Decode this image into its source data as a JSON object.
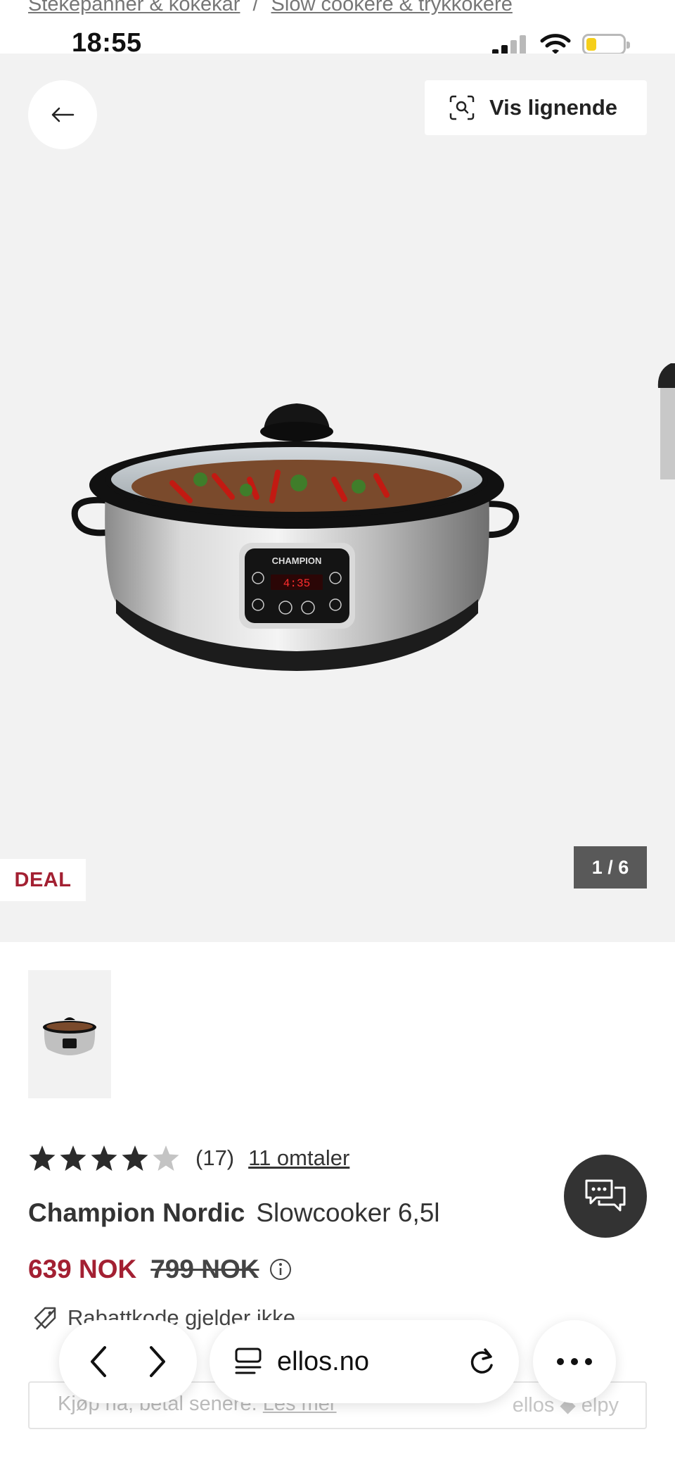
{
  "breadcrumb": {
    "items": [
      "Stekepanner & kokekar",
      "Slow cookere & trykkokere"
    ],
    "separator": "/"
  },
  "status_bar": {
    "time": "18:55",
    "signal_icon": "cellular-signal-icon",
    "wifi_icon": "wifi-icon",
    "battery_level_fraction": 0.2,
    "battery_color": "#f5cf1b"
  },
  "gallery": {
    "back_icon": "arrow-left-icon",
    "similar_button": {
      "icon": "visual-search-icon",
      "label": "Vis lignende"
    },
    "badge": "DEAL",
    "counter": "1 / 6",
    "image_alt": "Champion slow cooker with glass lid and digital control panel"
  },
  "product": {
    "rating_value": 4,
    "rating_max": 5,
    "rating_count": "(17)",
    "reviews_link": "11 omtaler",
    "brand": "Champion Nordic",
    "name": "Slowcooker 6,5l",
    "price_now": "639 NOK",
    "price_was": "799 NOK",
    "discount_note": "Rabattkode gjelder ikke"
  },
  "klarna": {
    "text": "Kjøp nå, betal senere.",
    "link": "Les mer",
    "logo": "ellos ◆ elpy"
  },
  "browser": {
    "domain": "ellos.no",
    "back_icon": "chevron-left-icon",
    "forward_icon": "chevron-right-icon",
    "reader_icon": "reader-icon",
    "reload_icon": "reload-icon",
    "more_icon": "more-icon"
  },
  "colors": {
    "accent_red": "#a32032",
    "gallery_bg": "#f2f2f2",
    "chat_button": "#333333"
  }
}
